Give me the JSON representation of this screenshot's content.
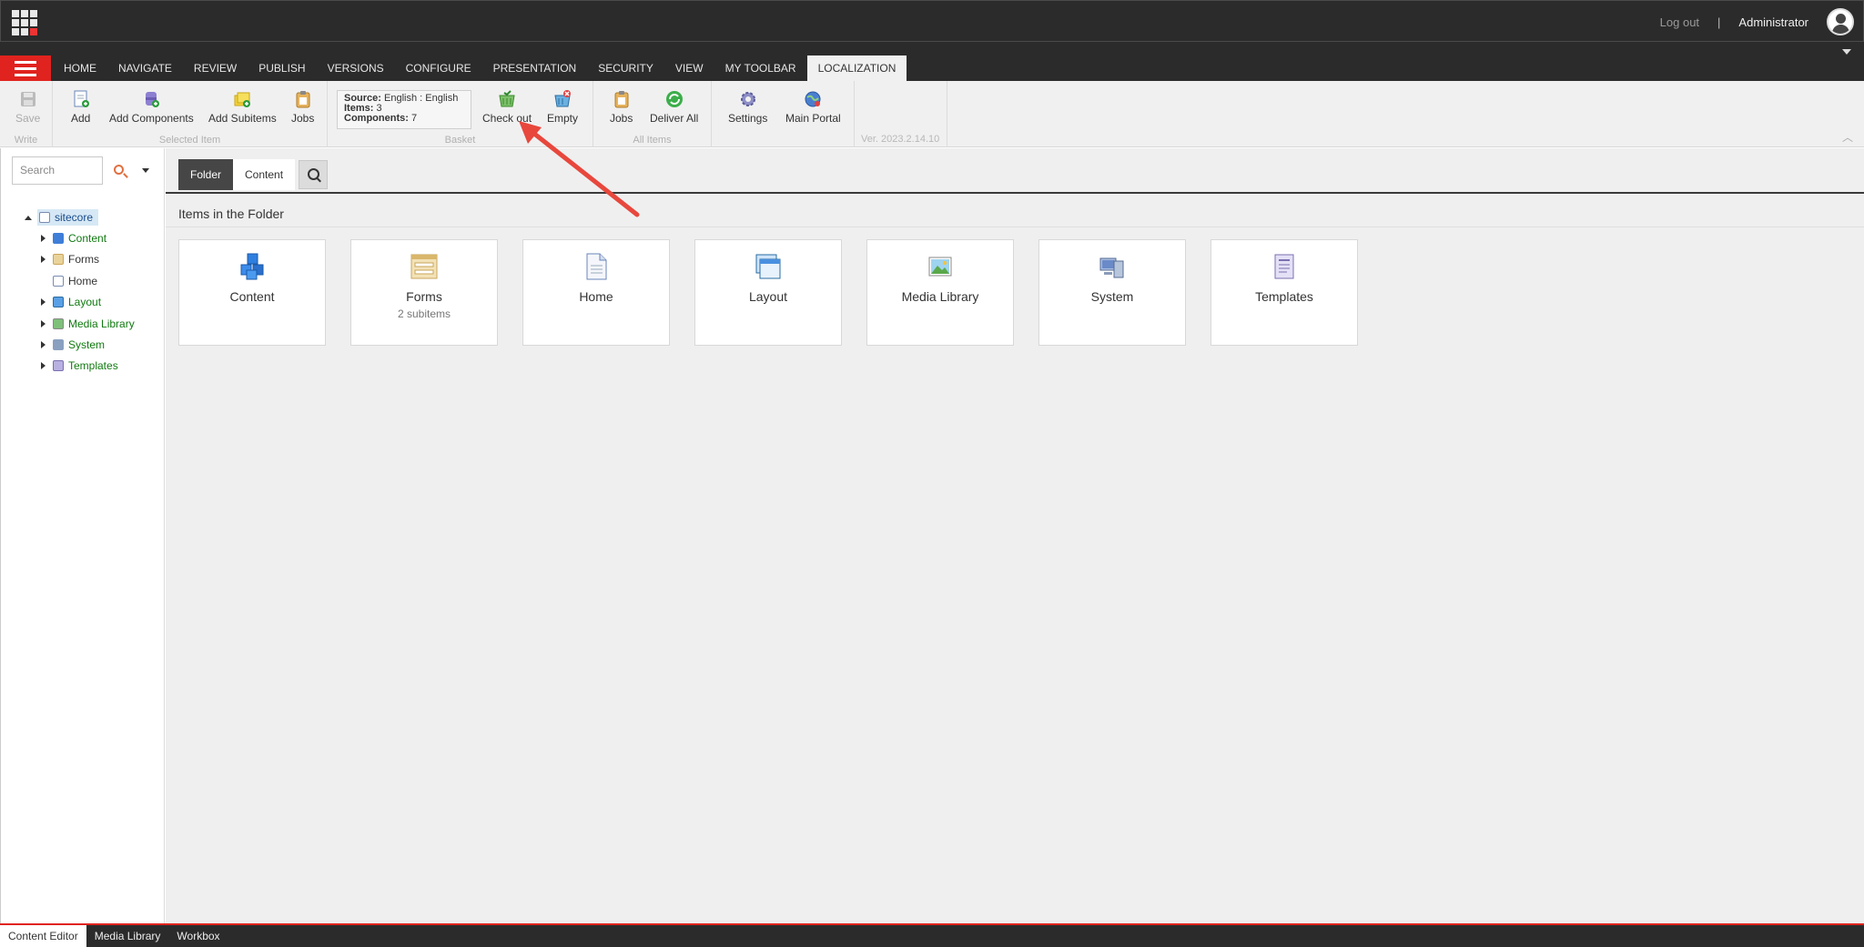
{
  "header": {
    "logout_label": "Log out",
    "separator": "|",
    "user_name": "Administrator"
  },
  "tabs": [
    "HOME",
    "NAVIGATE",
    "REVIEW",
    "PUBLISH",
    "VERSIONS",
    "CONFIGURE",
    "PRESENTATION",
    "SECURITY",
    "VIEW",
    "MY TOOLBAR",
    "LOCALIZATION"
  ],
  "active_tab": "LOCALIZATION",
  "ribbon": {
    "write": {
      "label": "Write",
      "save": "Save"
    },
    "selected_item": {
      "label": "Selected Item",
      "add": "Add",
      "add_components": "Add Components",
      "add_subitems": "Add Subitems",
      "jobs": "Jobs"
    },
    "basket": {
      "label": "Basket",
      "source_key": "Source:",
      "source_value": "English : English",
      "items_key": "Items:",
      "items_value": "3",
      "components_key": "Components:",
      "components_value": "7",
      "check_out": "Check out",
      "empty": "Empty"
    },
    "all_items": {
      "label": "All Items",
      "jobs": "Jobs",
      "deliver_all": "Deliver All"
    },
    "portal": {
      "settings": "Settings",
      "main_portal": "Main Portal"
    },
    "version": "Ver. 2023.2.14.10"
  },
  "search": {
    "placeholder": "Search"
  },
  "tree": {
    "root": "sitecore",
    "children": [
      {
        "label": "Content",
        "expandable": true,
        "color": "#117a11"
      },
      {
        "label": "Forms",
        "expandable": true,
        "color": "#333333"
      },
      {
        "label": "Home",
        "expandable": false,
        "color": "#333333"
      },
      {
        "label": "Layout",
        "expandable": true,
        "color": "#117a11"
      },
      {
        "label": "Media Library",
        "expandable": true,
        "color": "#117a11"
      },
      {
        "label": "System",
        "expandable": true,
        "color": "#117a11"
      },
      {
        "label": "Templates",
        "expandable": true,
        "color": "#117a11"
      }
    ]
  },
  "editor": {
    "tab_folder": "Folder",
    "tab_content": "Content",
    "folder_title": "Items in the Folder",
    "cards": [
      {
        "name": "Content",
        "sub": "",
        "icon": "content-cubes-icon"
      },
      {
        "name": "Forms",
        "sub": "2 subitems",
        "icon": "forms-icon"
      },
      {
        "name": "Home",
        "sub": "",
        "icon": "home-document-icon"
      },
      {
        "name": "Layout",
        "sub": "",
        "icon": "layout-window-icon"
      },
      {
        "name": "Media Library",
        "sub": "",
        "icon": "media-picture-icon"
      },
      {
        "name": "System",
        "sub": "",
        "icon": "system-computer-icon"
      },
      {
        "name": "Templates",
        "sub": "",
        "icon": "templates-icon"
      }
    ]
  },
  "bottom_tabs": [
    "Content Editor",
    "Media Library",
    "Workbox"
  ],
  "colors": {
    "accent_red": "#e0231e",
    "dark_bar": "#2b2b2b",
    "tree_green": "#117a11",
    "annotation_arrow": "#e8473c"
  }
}
